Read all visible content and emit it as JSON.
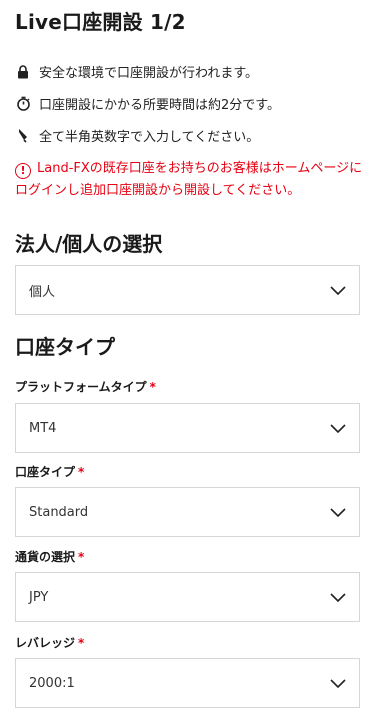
{
  "header": {
    "title": "Live口座開設 1/2"
  },
  "info": [
    {
      "icon": "lock-icon",
      "text": "安全な環境で口座開設が行われます。"
    },
    {
      "icon": "stopwatch-icon",
      "text": "口座開設にかかる所要時間は約2分です。"
    },
    {
      "icon": "pen-icon",
      "text": "全て半角英数字で入力してください。"
    }
  ],
  "warning": {
    "icon": "alert-circle-icon",
    "text": "Land-FXの既存口座をお持ちのお客様はホームページにログインし追加口座開設から開設してください。"
  },
  "entity_section": {
    "title": "法人/個人の選択",
    "select_value": "個人"
  },
  "account_section": {
    "title": "口座タイプ",
    "fields": [
      {
        "label": "プラットフォームタイプ",
        "required": "*",
        "value": "MT4"
      },
      {
        "label": "口座タイプ",
        "required": "*",
        "value": "Standard"
      },
      {
        "label": "通貨の選択",
        "required": "*",
        "value": "JPY"
      },
      {
        "label": "レバレッジ",
        "required": "*",
        "value": "2000:1"
      }
    ]
  },
  "colors": {
    "warning": "#e60012",
    "border": "#d6d6d6",
    "text": "#222222"
  }
}
